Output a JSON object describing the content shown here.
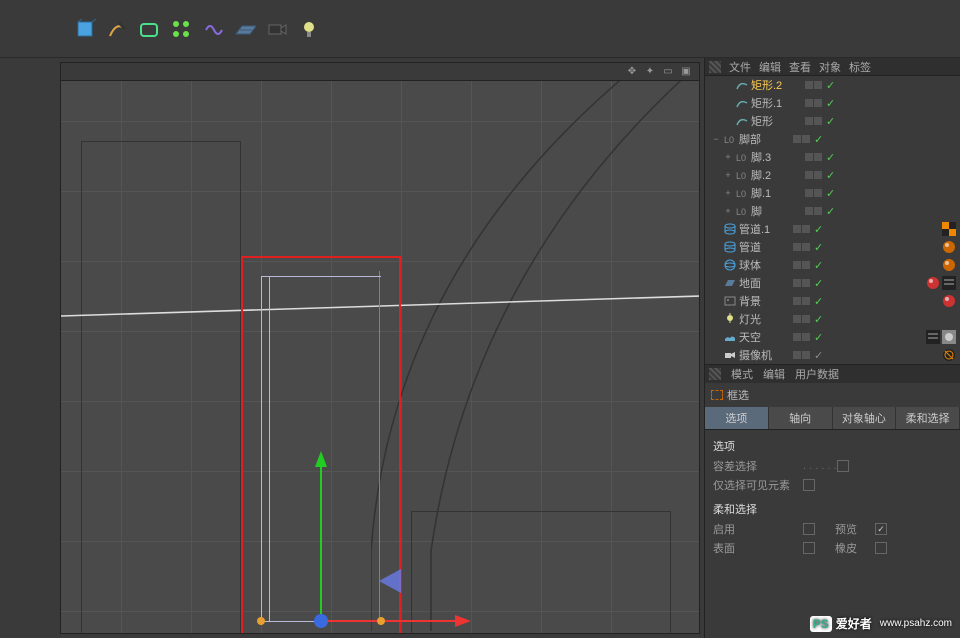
{
  "toolbar": {
    "tools": [
      {
        "name": "cube",
        "color": "#4aa3e0"
      },
      {
        "name": "pen",
        "color": "#e0a44a"
      },
      {
        "name": "nurbs",
        "color": "#4ae08a"
      },
      {
        "name": "array",
        "color": "#6ae04a"
      },
      {
        "name": "deformer",
        "color": "#8a6ae0"
      },
      {
        "name": "floor",
        "color": "#5a7a9a"
      },
      {
        "name": "camera",
        "color": "#444"
      },
      {
        "name": "light",
        "color": "#e0e08a"
      }
    ]
  },
  "viewport_header": [
    "move",
    "cross",
    "rect",
    "max"
  ],
  "object_header": [
    "文件",
    "编辑",
    "查看",
    "对象",
    "标签"
  ],
  "objects": [
    {
      "indent": 1,
      "expand": "",
      "icon": "spline",
      "iconColor": "#6aa",
      "name": "矩形.2",
      "selected": true,
      "check": true
    },
    {
      "indent": 1,
      "expand": "",
      "icon": "spline",
      "iconColor": "#6aa",
      "name": "矩形.1",
      "selected": false,
      "check": true
    },
    {
      "indent": 1,
      "expand": "",
      "icon": "spline",
      "iconColor": "#6aa",
      "name": "矩形",
      "selected": false,
      "check": true
    },
    {
      "indent": 0,
      "expand": "−",
      "icon": "null",
      "iconColor": "#888",
      "name": "脚部",
      "selected": false,
      "check": true
    },
    {
      "indent": 1,
      "expand": "+",
      "icon": "null",
      "iconColor": "#888",
      "name": "脚.3",
      "selected": false,
      "check": true
    },
    {
      "indent": 1,
      "expand": "+",
      "icon": "null",
      "iconColor": "#888",
      "name": "脚.2",
      "selected": false,
      "check": true
    },
    {
      "indent": 1,
      "expand": "+",
      "icon": "null",
      "iconColor": "#888",
      "name": "脚.1",
      "selected": false,
      "check": true
    },
    {
      "indent": 1,
      "expand": "+",
      "icon": "null",
      "iconColor": "#888",
      "name": "脚",
      "selected": false,
      "check": true
    },
    {
      "indent": 0,
      "expand": "",
      "icon": "tube",
      "iconColor": "#4aa3e0",
      "name": "管道.1",
      "selected": false,
      "check": true,
      "tags": [
        {
          "type": "checker",
          "c1": "#222",
          "c2": "#e80"
        }
      ]
    },
    {
      "indent": 0,
      "expand": "",
      "icon": "tube",
      "iconColor": "#4aa3e0",
      "name": "管道",
      "selected": false,
      "check": true,
      "tags": [
        {
          "type": "ball",
          "color": "#c60"
        }
      ]
    },
    {
      "indent": 0,
      "expand": "",
      "icon": "sphere",
      "iconColor": "#4aa3e0",
      "name": "球体",
      "selected": false,
      "check": true,
      "tags": [
        {
          "type": "ball",
          "color": "#c60"
        }
      ]
    },
    {
      "indent": 0,
      "expand": "",
      "icon": "floor",
      "iconColor": "#5a7a9a",
      "name": "地面",
      "selected": false,
      "check": true,
      "tags": [
        {
          "type": "ball",
          "color": "#c33"
        },
        {
          "type": "comp",
          "color": "#333"
        }
      ]
    },
    {
      "indent": 0,
      "expand": "",
      "icon": "bg",
      "iconColor": "#888",
      "name": "背景",
      "selected": false,
      "check": true,
      "tags": [
        {
          "type": "ball",
          "color": "#c33"
        }
      ]
    },
    {
      "indent": 0,
      "expand": "",
      "icon": "light",
      "iconColor": "#e0e08a",
      "name": "灯光",
      "selected": false,
      "check": true
    },
    {
      "indent": 0,
      "expand": "",
      "icon": "sky",
      "iconColor": "#6ac",
      "name": "天空",
      "selected": false,
      "check": true,
      "tags": [
        {
          "type": "comp",
          "color": "#333"
        },
        {
          "type": "tex",
          "color": "#aaa"
        }
      ]
    },
    {
      "indent": 0,
      "expand": "",
      "icon": "camera",
      "iconColor": "#ccc",
      "name": "摄像机",
      "selected": false,
      "check": false,
      "tags": [
        {
          "type": "target",
          "color": "#e80"
        }
      ]
    }
  ],
  "attr": {
    "header": [
      "模式",
      "编辑",
      "用户数据"
    ],
    "title": "框选",
    "tabs": [
      {
        "label": "选项",
        "active": true
      },
      {
        "label": "轴向",
        "active": false
      },
      {
        "label": "对象轴心",
        "active": false
      },
      {
        "label": "柔和选择",
        "active": false
      }
    ],
    "section1_title": "选项",
    "tolerance_label": "容差选择",
    "visible_label": "仅选择可见元素",
    "section2_title": "柔和选择",
    "enable_label": "启用",
    "preview_label": "预览",
    "preview_checked": "✓",
    "surface_label": "表面",
    "rubber_label": "橡皮"
  },
  "watermark": {
    "logo": "PS",
    "text": "爱好者",
    "url": "www.psahz.com"
  }
}
